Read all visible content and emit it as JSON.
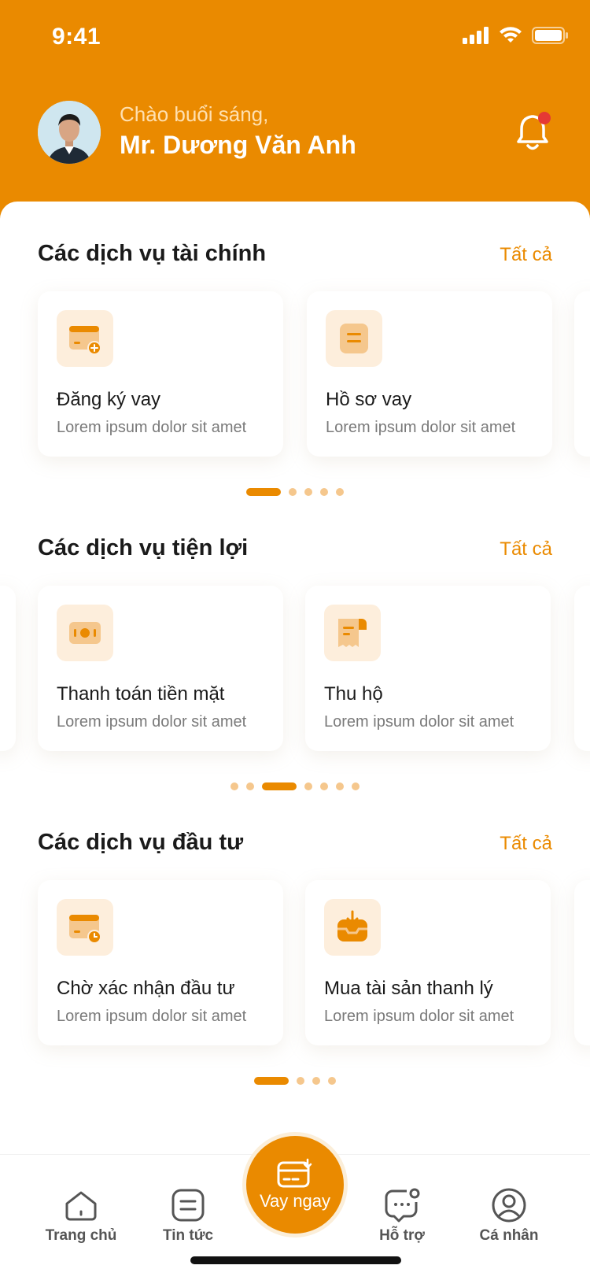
{
  "status": {
    "time": "9:41"
  },
  "header": {
    "greeting": "Chào buổi sáng,",
    "user_name": "Mr. Dương Văn Anh",
    "accent": "#ea8a00",
    "notification_dot": "#e53935"
  },
  "sections": [
    {
      "title": "Các dịch vụ tài chính",
      "see_all": "Tất cả",
      "cards": [
        {
          "icon": "card-add-icon",
          "title": "Đăng ký vay",
          "desc": "Lorem ipsum dolor sit amet"
        },
        {
          "icon": "document-icon",
          "title": "Hồ sơ vay",
          "desc": "Lorem ipsum dolor sit amet"
        }
      ],
      "pager": {
        "count": 5,
        "active": 0
      }
    },
    {
      "title": "Các dịch vụ tiện lợi",
      "see_all": "Tất cả",
      "cards": [
        {
          "icon": "cash-icon",
          "title": "Thanh toán tiền mặt",
          "desc": "Lorem ipsum dolor sit amet"
        },
        {
          "icon": "receipt-icon",
          "title": "Thu hộ",
          "desc": "Lorem ipsum dolor sit amet"
        }
      ],
      "pager": {
        "count": 7,
        "active": 2
      }
    },
    {
      "title": "Các dịch vụ đầu tư",
      "see_all": "Tất cả",
      "cards": [
        {
          "icon": "card-clock-icon",
          "title": "Chờ xác nhận đầu tư",
          "desc": "Lorem ipsum dolor sit amet"
        },
        {
          "icon": "inbox-download-icon",
          "title": "Mua tài sản thanh lý",
          "desc": "Lorem ipsum dolor sit amet"
        }
      ],
      "pager": {
        "count": 4,
        "active": 0
      }
    }
  ],
  "tabbar": {
    "home": "Trang chủ",
    "news": "Tin tức",
    "loan_now": "Vay ngay",
    "support": "Hỗ trợ",
    "profile": "Cá nhân"
  }
}
